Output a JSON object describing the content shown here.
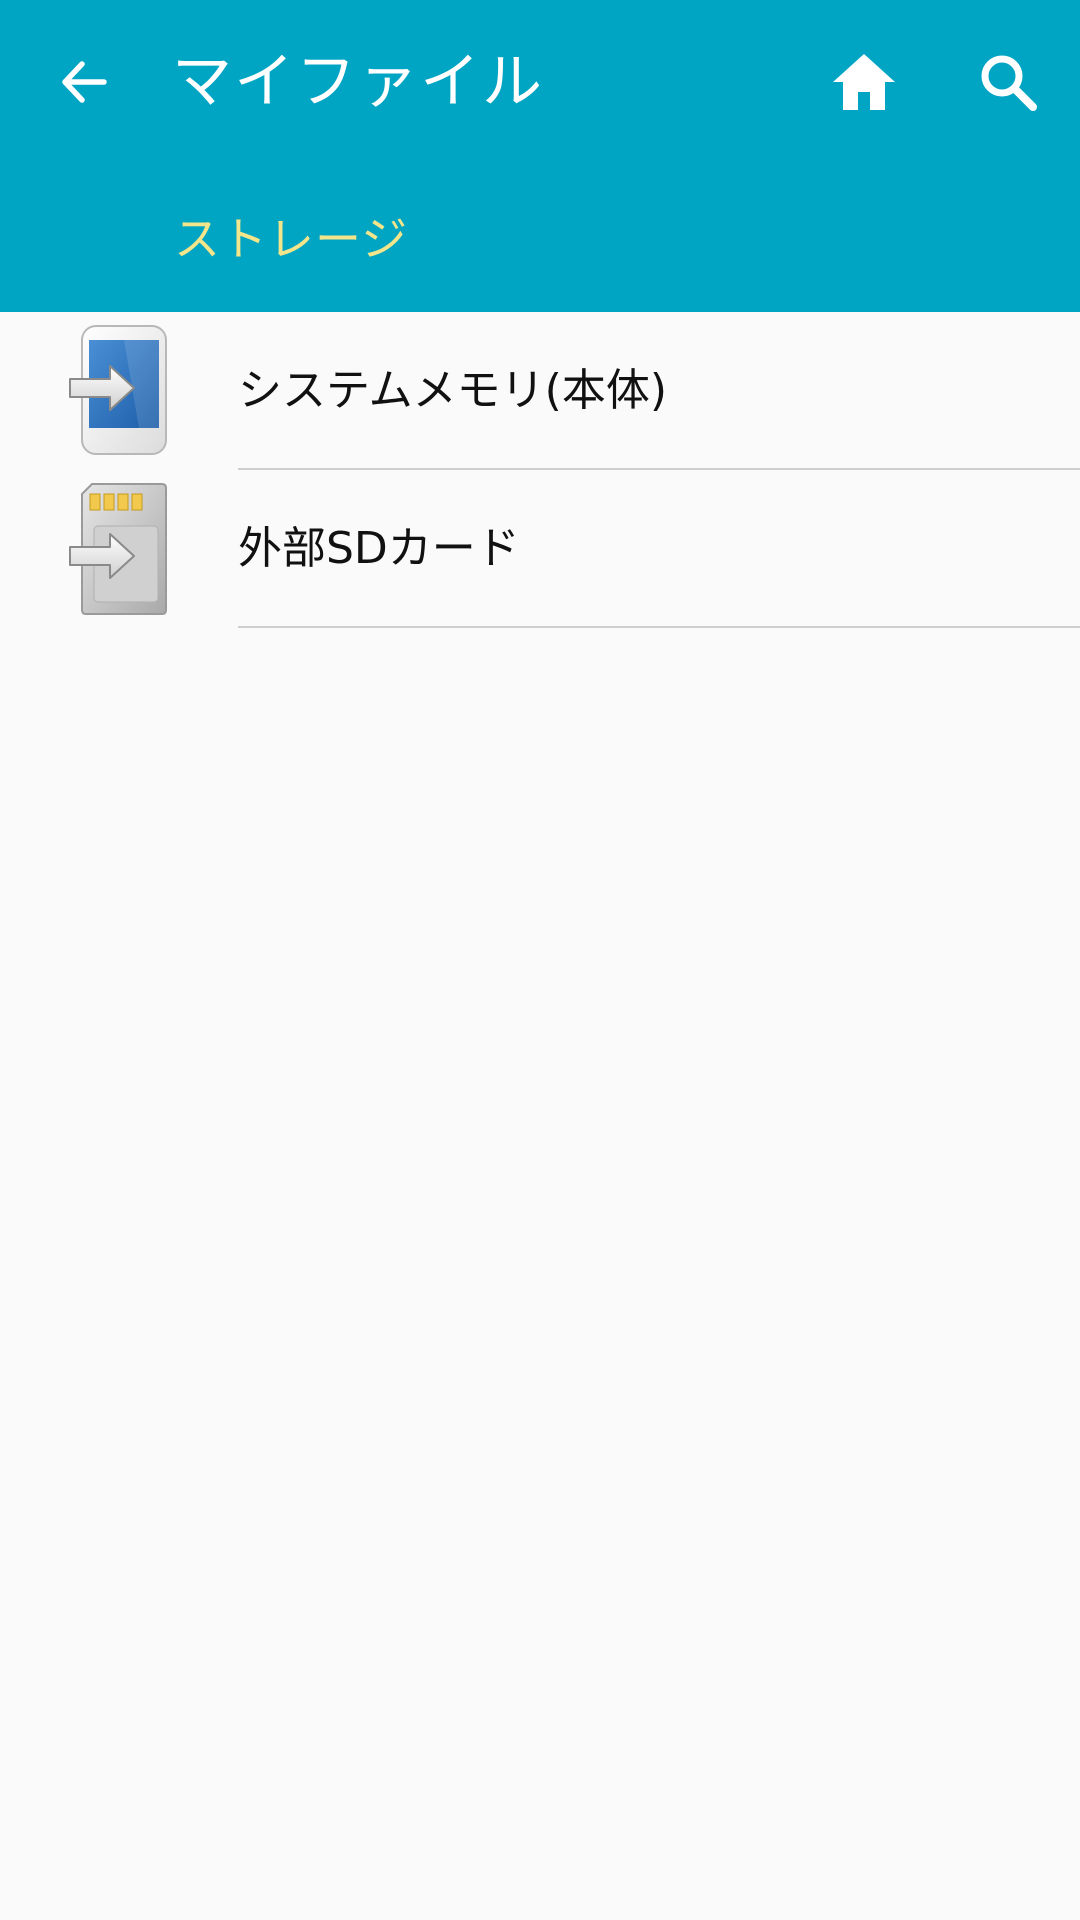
{
  "app_bar": {
    "title": "マイファイル",
    "back_icon": "arrow-back-icon",
    "home_icon": "home-icon",
    "search_icon": "search-icon",
    "background_color": "#00a5c4"
  },
  "section": {
    "label": "ストレージ",
    "label_color": "#f3e58a"
  },
  "storage_list": [
    {
      "label": "システムメモリ(本体)",
      "icon": "phone-storage-icon"
    },
    {
      "label": "外部SDカード",
      "icon": "sd-card-icon"
    }
  ]
}
